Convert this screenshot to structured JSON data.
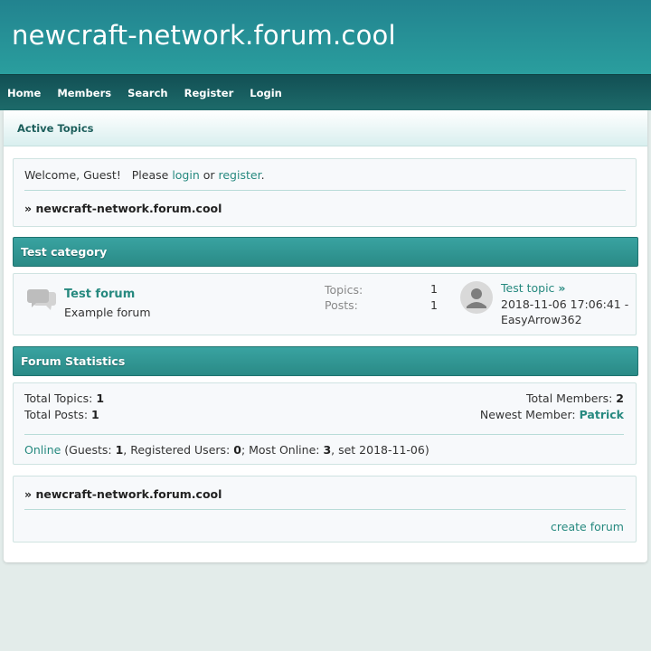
{
  "site": {
    "title": "newcraft-network.forum.cool"
  },
  "nav": {
    "items": [
      "Home",
      "Members",
      "Search",
      "Register",
      "Login"
    ]
  },
  "subnav": {
    "active_topics": "Active Topics"
  },
  "welcome": {
    "prefix": "Welcome, Guest!   Please ",
    "login": "login",
    "or": " or ",
    "register": "register",
    "suffix": ".",
    "breadcrumb_marker": "»",
    "breadcrumb": "newcraft-network.forum.cool"
  },
  "category": {
    "title": "Test category",
    "forum": {
      "name": "Test forum",
      "description": "Example forum",
      "topics_label": "Topics:",
      "topics_value": "1",
      "posts_label": "Posts:",
      "posts_value": "1",
      "last_topic": "Test topic",
      "last_topic_arrow": "»",
      "last_date": "2018-11-06 17:06:41 -",
      "last_user": "EasyArrow362"
    }
  },
  "stats": {
    "title": "Forum Statistics",
    "total_topics_label": "Total Topics:",
    "total_topics": "1",
    "total_posts_label": "Total Posts:",
    "total_posts": "1",
    "total_members_label": "Total Members:",
    "total_members": "2",
    "newest_member_label": "Newest Member:",
    "newest_member": "Patrick",
    "online_link": "Online",
    "guests_label": " (Guests: ",
    "guests": "1",
    "registered_label": ", Registered Users: ",
    "registered": "0",
    "most_label": "; Most Online: ",
    "most": "3",
    "most_suffix": ", set 2018-11-06)"
  },
  "footer": {
    "breadcrumb_marker": "»",
    "breadcrumb": "newcraft-network.forum.cool",
    "create_forum": "create forum"
  },
  "colors": {
    "header": "#2a9e9e",
    "nav": "#124f54",
    "accent": "#26897f",
    "background": "#e3ecea"
  }
}
